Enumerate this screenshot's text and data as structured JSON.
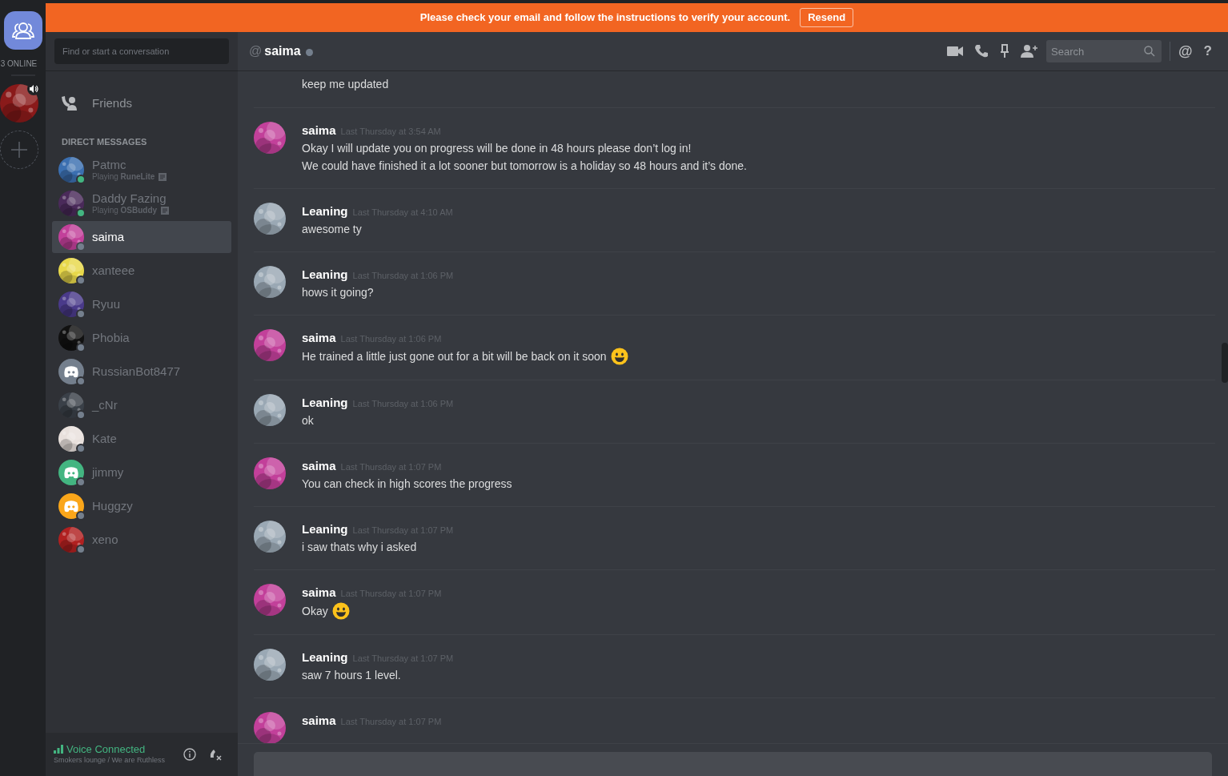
{
  "banner": {
    "text": "Please check your email and follow the instructions to verify your account.",
    "button": "Resend"
  },
  "guilds": {
    "online_count": "3 ONLINE",
    "servers": [
      {
        "kind": "picture",
        "color": "#8a1a1a",
        "speaking": true
      }
    ]
  },
  "dm_sidebar": {
    "search": {
      "placeholder": "Find or start a conversation"
    },
    "friends": "Friends",
    "section": "DIRECT MESSAGES",
    "items": [
      {
        "name": "Patmc",
        "color": "#43b581",
        "activity": "Playing **RuneLite**",
        "selected": false,
        "avatar": {
          "kind": "picture",
          "color": "#3b6fb0"
        }
      },
      {
        "name": "Daddy Fazing",
        "color": "#43b581",
        "activity": "Playing **OSBuddy**",
        "selected": false,
        "avatar": {
          "kind": "picture",
          "color": "#4a2a5a"
        }
      },
      {
        "name": "saima",
        "color": "#747f8d",
        "selected": true,
        "avatar": {
          "kind": "picture",
          "color": "#c2409a"
        }
      },
      {
        "name": "xanteee",
        "color": "#747f8d",
        "selected": false,
        "avatar": {
          "kind": "picture",
          "color": "#e8d84a"
        }
      },
      {
        "name": "Ryuu",
        "color": "#747f8d",
        "selected": false,
        "avatar": {
          "kind": "picture",
          "color": "#4a3a8a"
        }
      },
      {
        "name": "Phobia",
        "color": "#747f8d",
        "selected": false,
        "avatar": {
          "kind": "picture",
          "color": "#111111"
        }
      },
      {
        "name": "RussianBot8477",
        "color": "#747f8d",
        "selected": false,
        "avatar": {
          "kind": "default",
          "color": "#747f8d"
        }
      },
      {
        "name": "_cNr",
        "color": "#747f8d",
        "selected": false,
        "avatar": {
          "kind": "picture",
          "color": "#3a4048"
        }
      },
      {
        "name": "Kate",
        "color": "#747f8d",
        "selected": false,
        "avatar": {
          "kind": "picture",
          "color": "#e8e0dc"
        }
      },
      {
        "name": "jimmy",
        "color": "#747f8d",
        "selected": false,
        "avatar": {
          "kind": "default",
          "color": "#43b581"
        }
      },
      {
        "name": "Huggzy",
        "color": "#747f8d",
        "selected": false,
        "avatar": {
          "kind": "default",
          "color": "#faa61a"
        }
      },
      {
        "name": "xeno",
        "color": "#747f8d",
        "selected": false,
        "avatar": {
          "kind": "picture",
          "color": "#b02020"
        }
      }
    ],
    "voice": {
      "title": "Voice Connected",
      "channel": "Smokers lounge / We are Ruthless"
    }
  },
  "chat": {
    "prefix": "@",
    "title": "saima",
    "status_dot": {
      "color": "#747f8d"
    },
    "search": {
      "placeholder": "Search"
    },
    "mentions_button": "@",
    "help_button": "?",
    "messages": [
      {
        "kind": "continuation",
        "lines": [
          {
            "text": "keep me updated",
            "emoji": false
          }
        ]
      },
      {
        "kind": "group",
        "author": "saima",
        "time": "Last Thursday at 3:54 AM",
        "avatar": {
          "color": "#c2409a"
        },
        "lines": [
          {
            "text": "Okay I will update you on progress will be done in 48 hours please don’t log in!",
            "emoji": false
          },
          {
            "text": "We could have finished it a lot sooner but tomorrow is a holiday so 48 hours and it’s done.",
            "emoji": false
          }
        ]
      },
      {
        "kind": "group",
        "author": "Leaning",
        "time": "Last Thursday at 4:10 AM",
        "avatar": {
          "color": "#9aa8b4"
        },
        "lines": [
          {
            "text": "awesome ty",
            "emoji": false
          }
        ]
      },
      {
        "kind": "group",
        "author": "Leaning",
        "time": "Last Thursday at 1:06 PM",
        "avatar": {
          "color": "#9aa8b4"
        },
        "lines": [
          {
            "text": "hows it going?",
            "emoji": false
          }
        ]
      },
      {
        "kind": "group",
        "author": "saima",
        "time": "Last Thursday at 1:06 PM",
        "avatar": {
          "color": "#c2409a"
        },
        "lines": [
          {
            "text": "He trained a little just gone out for a bit will be back on it soon",
            "emoji": true
          }
        ]
      },
      {
        "kind": "group",
        "author": "Leaning",
        "time": "Last Thursday at 1:06 PM",
        "avatar": {
          "color": "#9aa8b4"
        },
        "lines": [
          {
            "text": "ok",
            "emoji": false
          }
        ]
      },
      {
        "kind": "group",
        "author": "saima",
        "time": "Last Thursday at 1:07 PM",
        "avatar": {
          "color": "#c2409a"
        },
        "lines": [
          {
            "text": "You can check in high scores the progress",
            "emoji": false
          }
        ]
      },
      {
        "kind": "group",
        "author": "Leaning",
        "time": "Last Thursday at 1:07 PM",
        "avatar": {
          "color": "#9aa8b4"
        },
        "lines": [
          {
            "text": "i saw thats why i asked",
            "emoji": false
          }
        ]
      },
      {
        "kind": "group",
        "author": "saima",
        "time": "Last Thursday at 1:07 PM",
        "avatar": {
          "color": "#c2409a"
        },
        "lines": [
          {
            "text": "Okay",
            "emoji": true
          }
        ]
      },
      {
        "kind": "group",
        "author": "Leaning",
        "time": "Last Thursday at 1:07 PM",
        "avatar": {
          "color": "#9aa8b4"
        },
        "lines": [
          {
            "text": "saw 7 hours 1 level.",
            "emoji": false
          }
        ]
      },
      {
        "kind": "group",
        "author": "saima",
        "time": "Last Thursday at 1:07 PM",
        "avatar": {
          "color": "#c2409a"
        }
      }
    ]
  }
}
